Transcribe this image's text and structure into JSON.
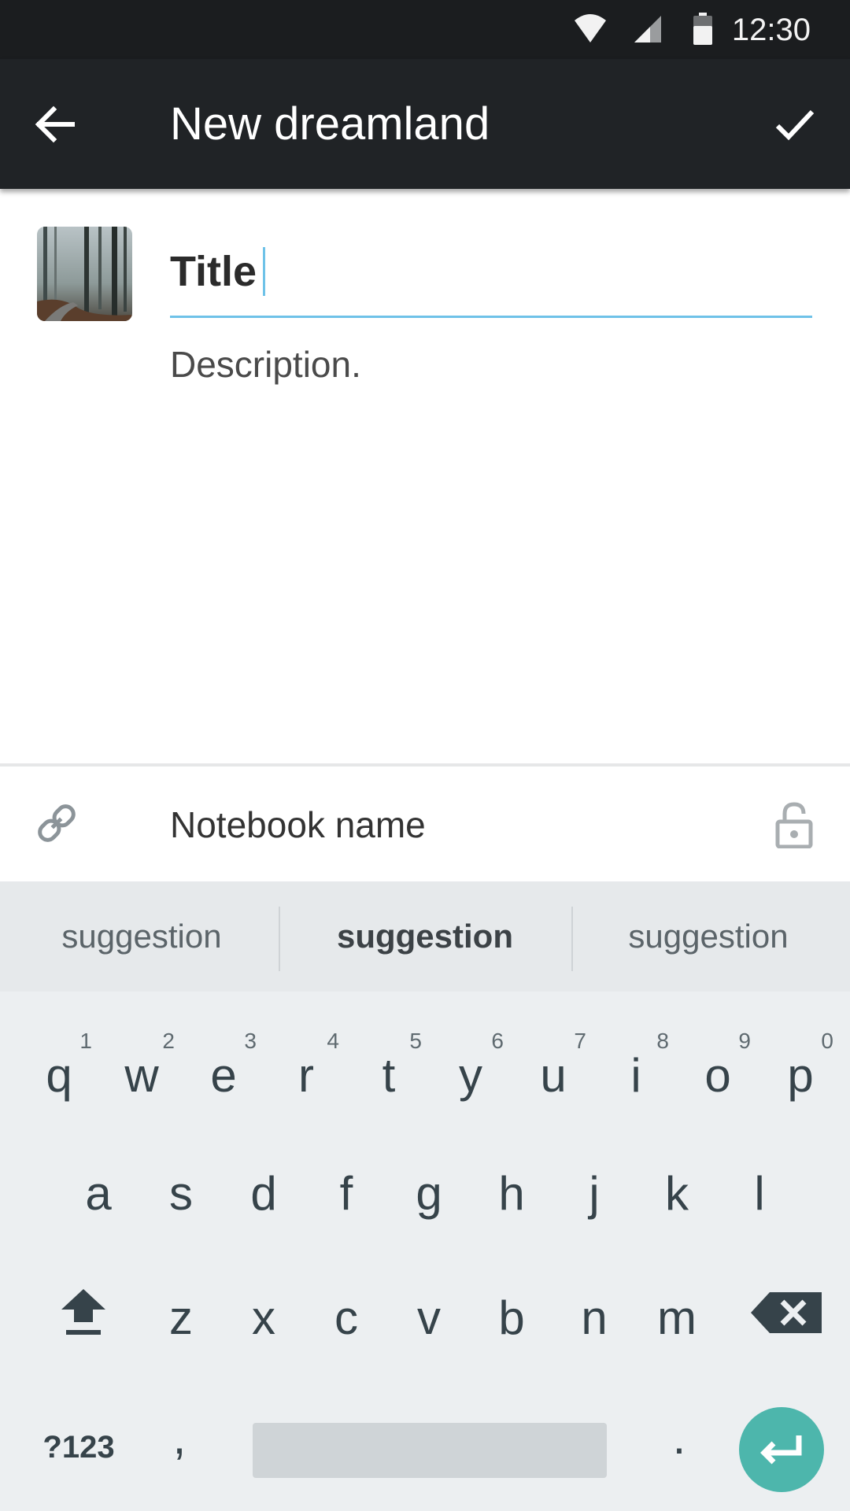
{
  "status_bar": {
    "time": "12:30",
    "icons": [
      "wifi-icon",
      "cell-signal-icon",
      "battery-icon"
    ]
  },
  "toolbar": {
    "title": "New dreamland",
    "back_icon": "arrow-back-icon",
    "confirm_icon": "check-icon"
  },
  "form": {
    "title_value": "Title",
    "description_placeholder": "Description."
  },
  "notebook": {
    "label": "Notebook name",
    "link_icon": "link-icon",
    "lock_icon": "lock-icon"
  },
  "keyboard": {
    "suggestions": [
      "suggestion",
      "suggestion",
      "suggestion"
    ],
    "row1": [
      {
        "key": "q",
        "hint": "1"
      },
      {
        "key": "w",
        "hint": "2"
      },
      {
        "key": "e",
        "hint": "3"
      },
      {
        "key": "r",
        "hint": "4"
      },
      {
        "key": "t",
        "hint": "5"
      },
      {
        "key": "y",
        "hint": "6"
      },
      {
        "key": "u",
        "hint": "7"
      },
      {
        "key": "i",
        "hint": "8"
      },
      {
        "key": "o",
        "hint": "9"
      },
      {
        "key": "p",
        "hint": "0"
      }
    ],
    "row2": [
      "a",
      "s",
      "d",
      "f",
      "g",
      "h",
      "j",
      "k",
      "l"
    ],
    "row3": [
      "z",
      "x",
      "c",
      "v",
      "b",
      "n",
      "m"
    ],
    "symbols_label": "?123",
    "comma": ",",
    "period": "."
  },
  "colors": {
    "status_bar": "#1b1d1f",
    "toolbar": "#202326",
    "accent_underline": "#6ec2e8",
    "enter_button": "#4db6ac",
    "keyboard_bg": "#eceff1"
  }
}
